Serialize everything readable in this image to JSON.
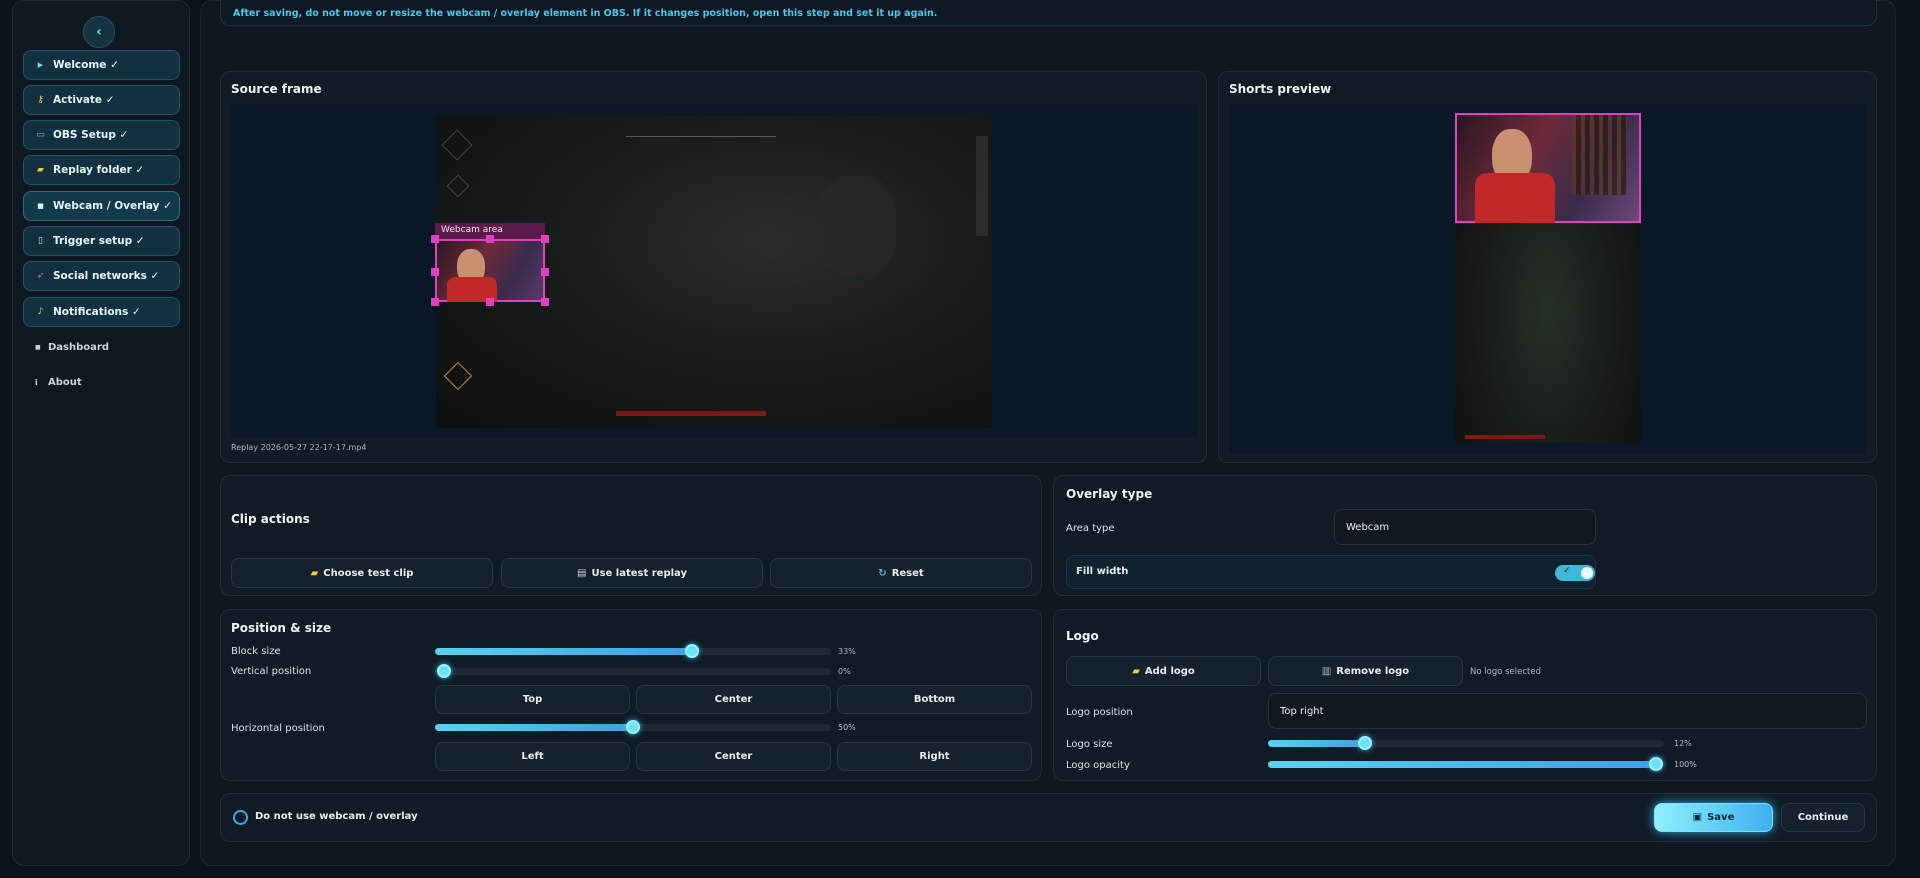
{
  "notice": "After saving, do not move or resize the webcam / overlay element in OBS. If it changes position, open this step and set it up again.",
  "sidebar": {
    "collapse_icon": "chevron-left-icon",
    "items": [
      {
        "label": "Welcome ✓",
        "icon": "play-icon"
      },
      {
        "label": "Activate ✓",
        "icon": "key-icon"
      },
      {
        "label": "OBS Setup ✓",
        "icon": "computer-icon"
      },
      {
        "label": "Replay folder ✓",
        "icon": "folder-icon"
      },
      {
        "label": "Webcam / Overlay ✓",
        "icon": "square-icon"
      },
      {
        "label": "Trigger setup ✓",
        "icon": "mouse-icon"
      },
      {
        "label": "Social networks ✓",
        "icon": "rocket-icon"
      },
      {
        "label": "Notifications ✓",
        "icon": "bell-icon"
      }
    ],
    "plain": [
      {
        "label": "Dashboard",
        "icon": "square-icon"
      },
      {
        "label": "About",
        "icon": "info-icon"
      }
    ]
  },
  "source": {
    "title": "Source frame",
    "webcam_label": "Webcam area",
    "filename": "Replay 2026-05-27 22-17-17.mp4"
  },
  "shorts": {
    "title": "Shorts preview"
  },
  "clip_actions": {
    "title": "Clip actions",
    "choose": "Choose test clip",
    "latest": "Use latest replay",
    "reset": "Reset"
  },
  "overlay_type": {
    "title": "Overlay type",
    "area_label": "Area type",
    "area_value": "Webcam",
    "fill_width_label": "Fill width",
    "fill_width": true
  },
  "position": {
    "title": "Position & size",
    "block_size_label": "Block size",
    "block_size": 0.33,
    "block_size_text": "33%",
    "vertical_label": "Vertical position",
    "vertical": 0.0,
    "vertical_text": "0%",
    "top": "Top",
    "center": "Center",
    "bottom": "Bottom",
    "horizontal_label": "Horizontal position",
    "horizontal": 0.5,
    "horizontal_text": "50%",
    "left": "Left",
    "center2": "Center",
    "right": "Right"
  },
  "logo": {
    "title": "Logo",
    "add": "Add logo",
    "remove": "Remove logo",
    "status": "No logo selected",
    "position_label": "Logo position",
    "position_value": "Top right",
    "size_label": "Logo size",
    "size": 0.12,
    "size_text": "12%",
    "opacity_label": "Logo opacity",
    "opacity": 1.0,
    "opacity_text": "100%"
  },
  "footer": {
    "checkbox_label": "Do not use webcam / overlay",
    "save": "Save",
    "continue": "Continue"
  },
  "colors": {
    "accent": "#4fc7ea",
    "webcam_border": "#e040c0"
  }
}
